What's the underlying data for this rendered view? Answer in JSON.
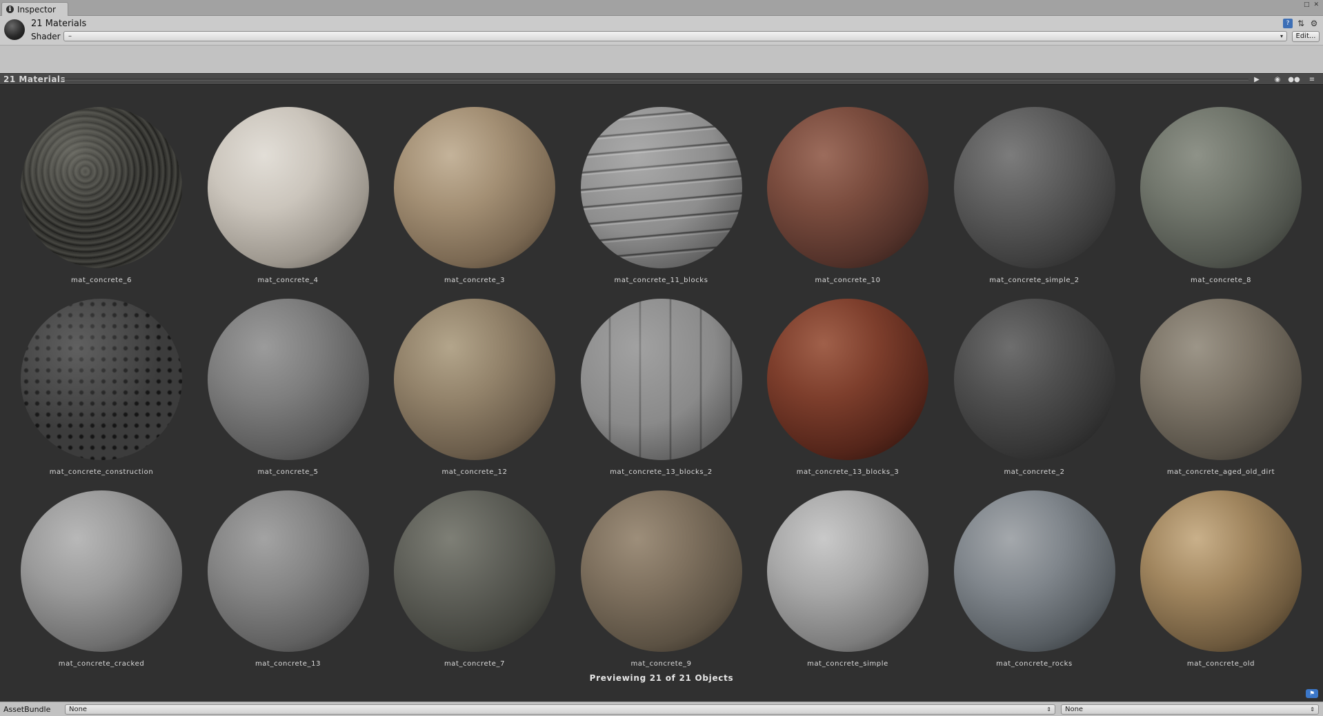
{
  "tab": {
    "icon": "info-icon",
    "label": "Inspector"
  },
  "header": {
    "title": "21 Materials",
    "shader_label": "Shader",
    "shader_value": "–",
    "edit_label": "Edit..."
  },
  "preview_bar": {
    "title": "21 Materials"
  },
  "materials": [
    {
      "name": "mat_concrete_6",
      "style": "s-dark-cells"
    },
    {
      "name": "mat_concrete_4",
      "style": "s-white-rough"
    },
    {
      "name": "mat_concrete_3",
      "style": "s-tan"
    },
    {
      "name": "mat_concrete_11_blocks",
      "style": "s-stripes"
    },
    {
      "name": "mat_concrete_10",
      "style": "s-red"
    },
    {
      "name": "mat_concrete_simple_2",
      "style": "s-grey-smooth"
    },
    {
      "name": "mat_concrete_8",
      "style": "s-green-grey"
    },
    {
      "name": "mat_concrete_construction",
      "style": "s-dots"
    },
    {
      "name": "mat_concrete_5",
      "style": "s-grey-rough"
    },
    {
      "name": "mat_concrete_12",
      "style": "s-brown-grey"
    },
    {
      "name": "mat_concrete_13_blocks_2",
      "style": "s-vlines"
    },
    {
      "name": "mat_concrete_13_blocks_3",
      "style": "s-red-smooth"
    },
    {
      "name": "mat_concrete_2",
      "style": "s-darkgrey"
    },
    {
      "name": "mat_concrete_aged_old_dirt",
      "style": "s-dirt"
    },
    {
      "name": "mat_concrete_cracked",
      "style": "s-light-grey"
    },
    {
      "name": "mat_concrete_13",
      "style": "s-mid-grey"
    },
    {
      "name": "mat_concrete_7",
      "style": "s-dark-mottled"
    },
    {
      "name": "mat_concrete_9",
      "style": "s-brown-fibre"
    },
    {
      "name": "mat_concrete_simple",
      "style": "s-white-smooth"
    },
    {
      "name": "mat_concrete_rocks",
      "style": "s-rocks"
    },
    {
      "name": "mat_concrete_old",
      "style": "s-old"
    }
  ],
  "footer": {
    "preview_text": "Previewing 21 of 21 Objects"
  },
  "asset_bundle": {
    "label": "AssetBundle",
    "bundle_value": "None",
    "variant_value": "None"
  }
}
